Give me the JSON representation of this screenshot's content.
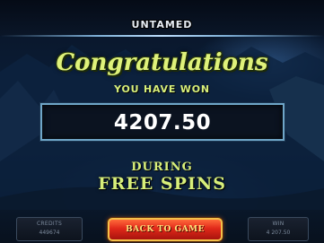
{
  "header": {
    "game_title": "UNTAMED"
  },
  "dialog": {
    "heading": "Congratulations",
    "subheading": "YOU HAVE WON",
    "win_amount": "4207.50",
    "during_label": "DURING",
    "feature_label": "FREE SPINS"
  },
  "footer": {
    "credits": {
      "label": "CREDITS",
      "value": "449674"
    },
    "back_button_label": "BACK TO GAME",
    "win": {
      "label": "WIN",
      "value": "4 207.50"
    }
  },
  "colors": {
    "accent_text": "#d8ef7a",
    "win_box_border": "#6fa6c8",
    "button_red": "#e0281a",
    "button_border": "#f2c04a"
  }
}
